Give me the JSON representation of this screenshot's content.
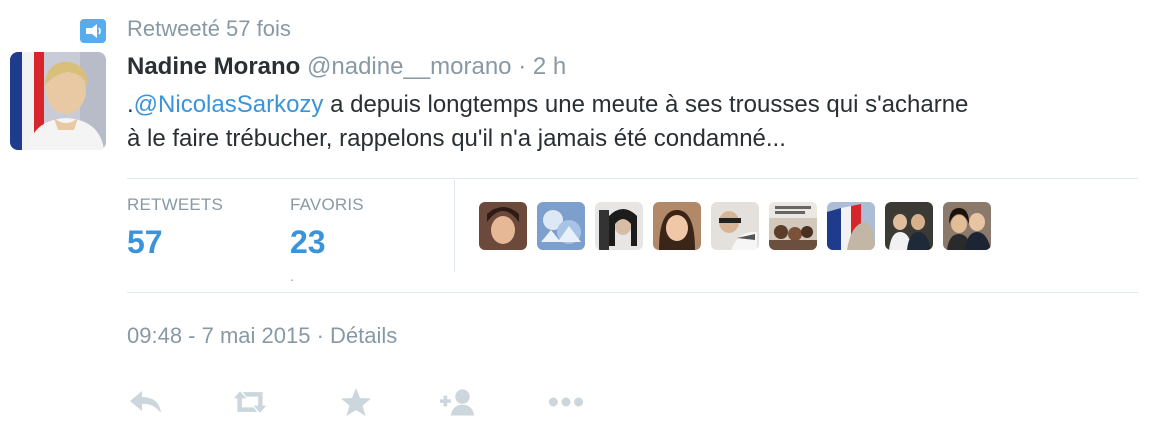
{
  "context": {
    "retweet_text": "Retweeté 57 fois",
    "icon": "retweet-context-icon",
    "icon_color": "#55acee"
  },
  "tweet": {
    "author_name": "Nadine Morano",
    "screen_name": "@nadine__morano",
    "separator": "·",
    "age": "2 h",
    "text_prefix": ".",
    "mention": "@NicolasSarkozy",
    "text_line1": " a depuis longtemps une meute à ses trousses qui s'acharne",
    "text_line2": "à le faire trébucher, rappelons qu'il n'a jamais été condamné..."
  },
  "stats": {
    "retweets_label": "RETWEETS",
    "retweets_count": "57",
    "favorites_label": "FAVORIS",
    "favorites_count": "23",
    "small_dot": "."
  },
  "favoriters": [
    {
      "name": "favoriter-1"
    },
    {
      "name": "favoriter-2"
    },
    {
      "name": "favoriter-3"
    },
    {
      "name": "favoriter-4"
    },
    {
      "name": "favoriter-5"
    },
    {
      "name": "favoriter-6"
    },
    {
      "name": "favoriter-7"
    },
    {
      "name": "favoriter-8"
    },
    {
      "name": "favoriter-9"
    }
  ],
  "meta": {
    "timestamp": "09:48 - 7 mai 2015",
    "separator": "·",
    "details_label": "Détails"
  },
  "actions": [
    {
      "icon": "reply-icon"
    },
    {
      "icon": "retweet-icon"
    },
    {
      "icon": "favorite-star-icon"
    },
    {
      "icon": "follow-icon"
    },
    {
      "icon": "more-icon"
    }
  ],
  "colors": {
    "link": "#3b94d9",
    "muted": "#8899a6",
    "text": "#292f33",
    "action_icon": "#ccd6dd",
    "divider": "#e1e8ed"
  }
}
